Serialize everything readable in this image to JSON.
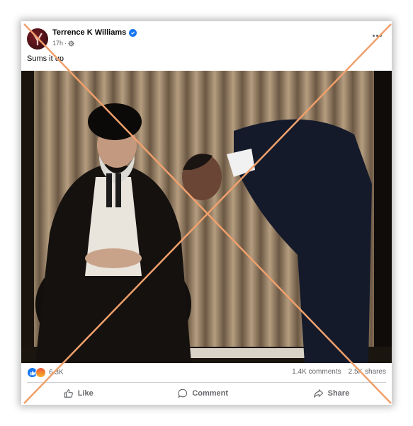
{
  "post": {
    "author": "Terrence K Williams",
    "time": "17h",
    "privacy_icon": "gear-icon",
    "caption": "Sums it up"
  },
  "stats": {
    "reaction_count": "6.3K",
    "comments": "1.4K comments",
    "shares": "2.5K shares"
  },
  "actions": {
    "like": "Like",
    "comment": "Comment",
    "share": "Share"
  },
  "colors": {
    "verified": "#1877f2",
    "cross_overlay": "#f0a06c",
    "secondary_text": "#65676b"
  }
}
